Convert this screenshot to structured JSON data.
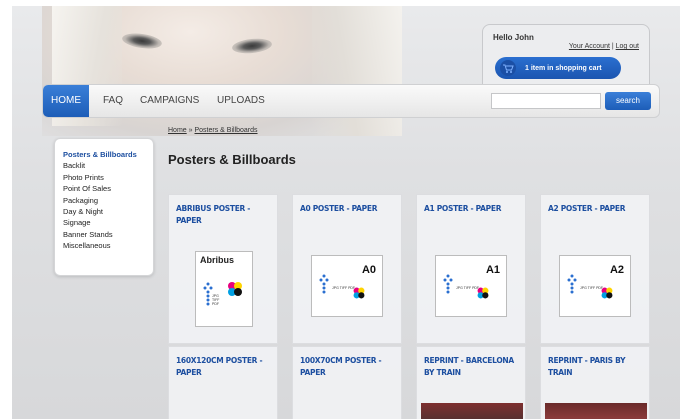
{
  "header": {
    "greeting": "Hello John",
    "account_link": "Your Account",
    "separator": "|",
    "logout_link": "Log out",
    "cart_label": "1 item in shopping cart"
  },
  "nav": {
    "items": [
      "HOME",
      "FAQ",
      "CAMPAIGNS",
      "UPLOADS"
    ],
    "search_placeholder": "",
    "search_button": "search"
  },
  "sidebar": {
    "items": [
      "Posters & Billboards",
      "Backlit",
      "Photo Prints",
      "Point Of Sales",
      "Packaging",
      "Day & Night",
      "Signage",
      "Banner Stands",
      "Miscellaneous"
    ]
  },
  "breadcrumb": {
    "home": "Home",
    "separator": "»",
    "current": "Posters & Billboards"
  },
  "page_title": "Posters & Billboards",
  "products": [
    {
      "title": "ABRIBUS POSTER - PAPER",
      "poster_text": "Abribus"
    },
    {
      "title": "A0 POSTER - PAPER",
      "poster_text": "A0"
    },
    {
      "title": "A1 POSTER - PAPER",
      "poster_text": "A1"
    },
    {
      "title": "A2 POSTER - PAPER",
      "poster_text": "A2"
    },
    {
      "title": "160X120CM POSTER - PAPER",
      "poster_text": ""
    },
    {
      "title": "100X70CM POSTER - PAPER",
      "poster_text": ""
    },
    {
      "title": "REPRINT - BARCELONA BY TRAIN",
      "poster_text": ""
    },
    {
      "title": "REPRINT - PARIS BY TRAIN",
      "poster_text": ""
    }
  ],
  "poster_formats": "JPG\nTIFF\nPDF",
  "colors": {
    "accent_blue": "#1d5db8",
    "title_blue": "#1d4fa0"
  }
}
